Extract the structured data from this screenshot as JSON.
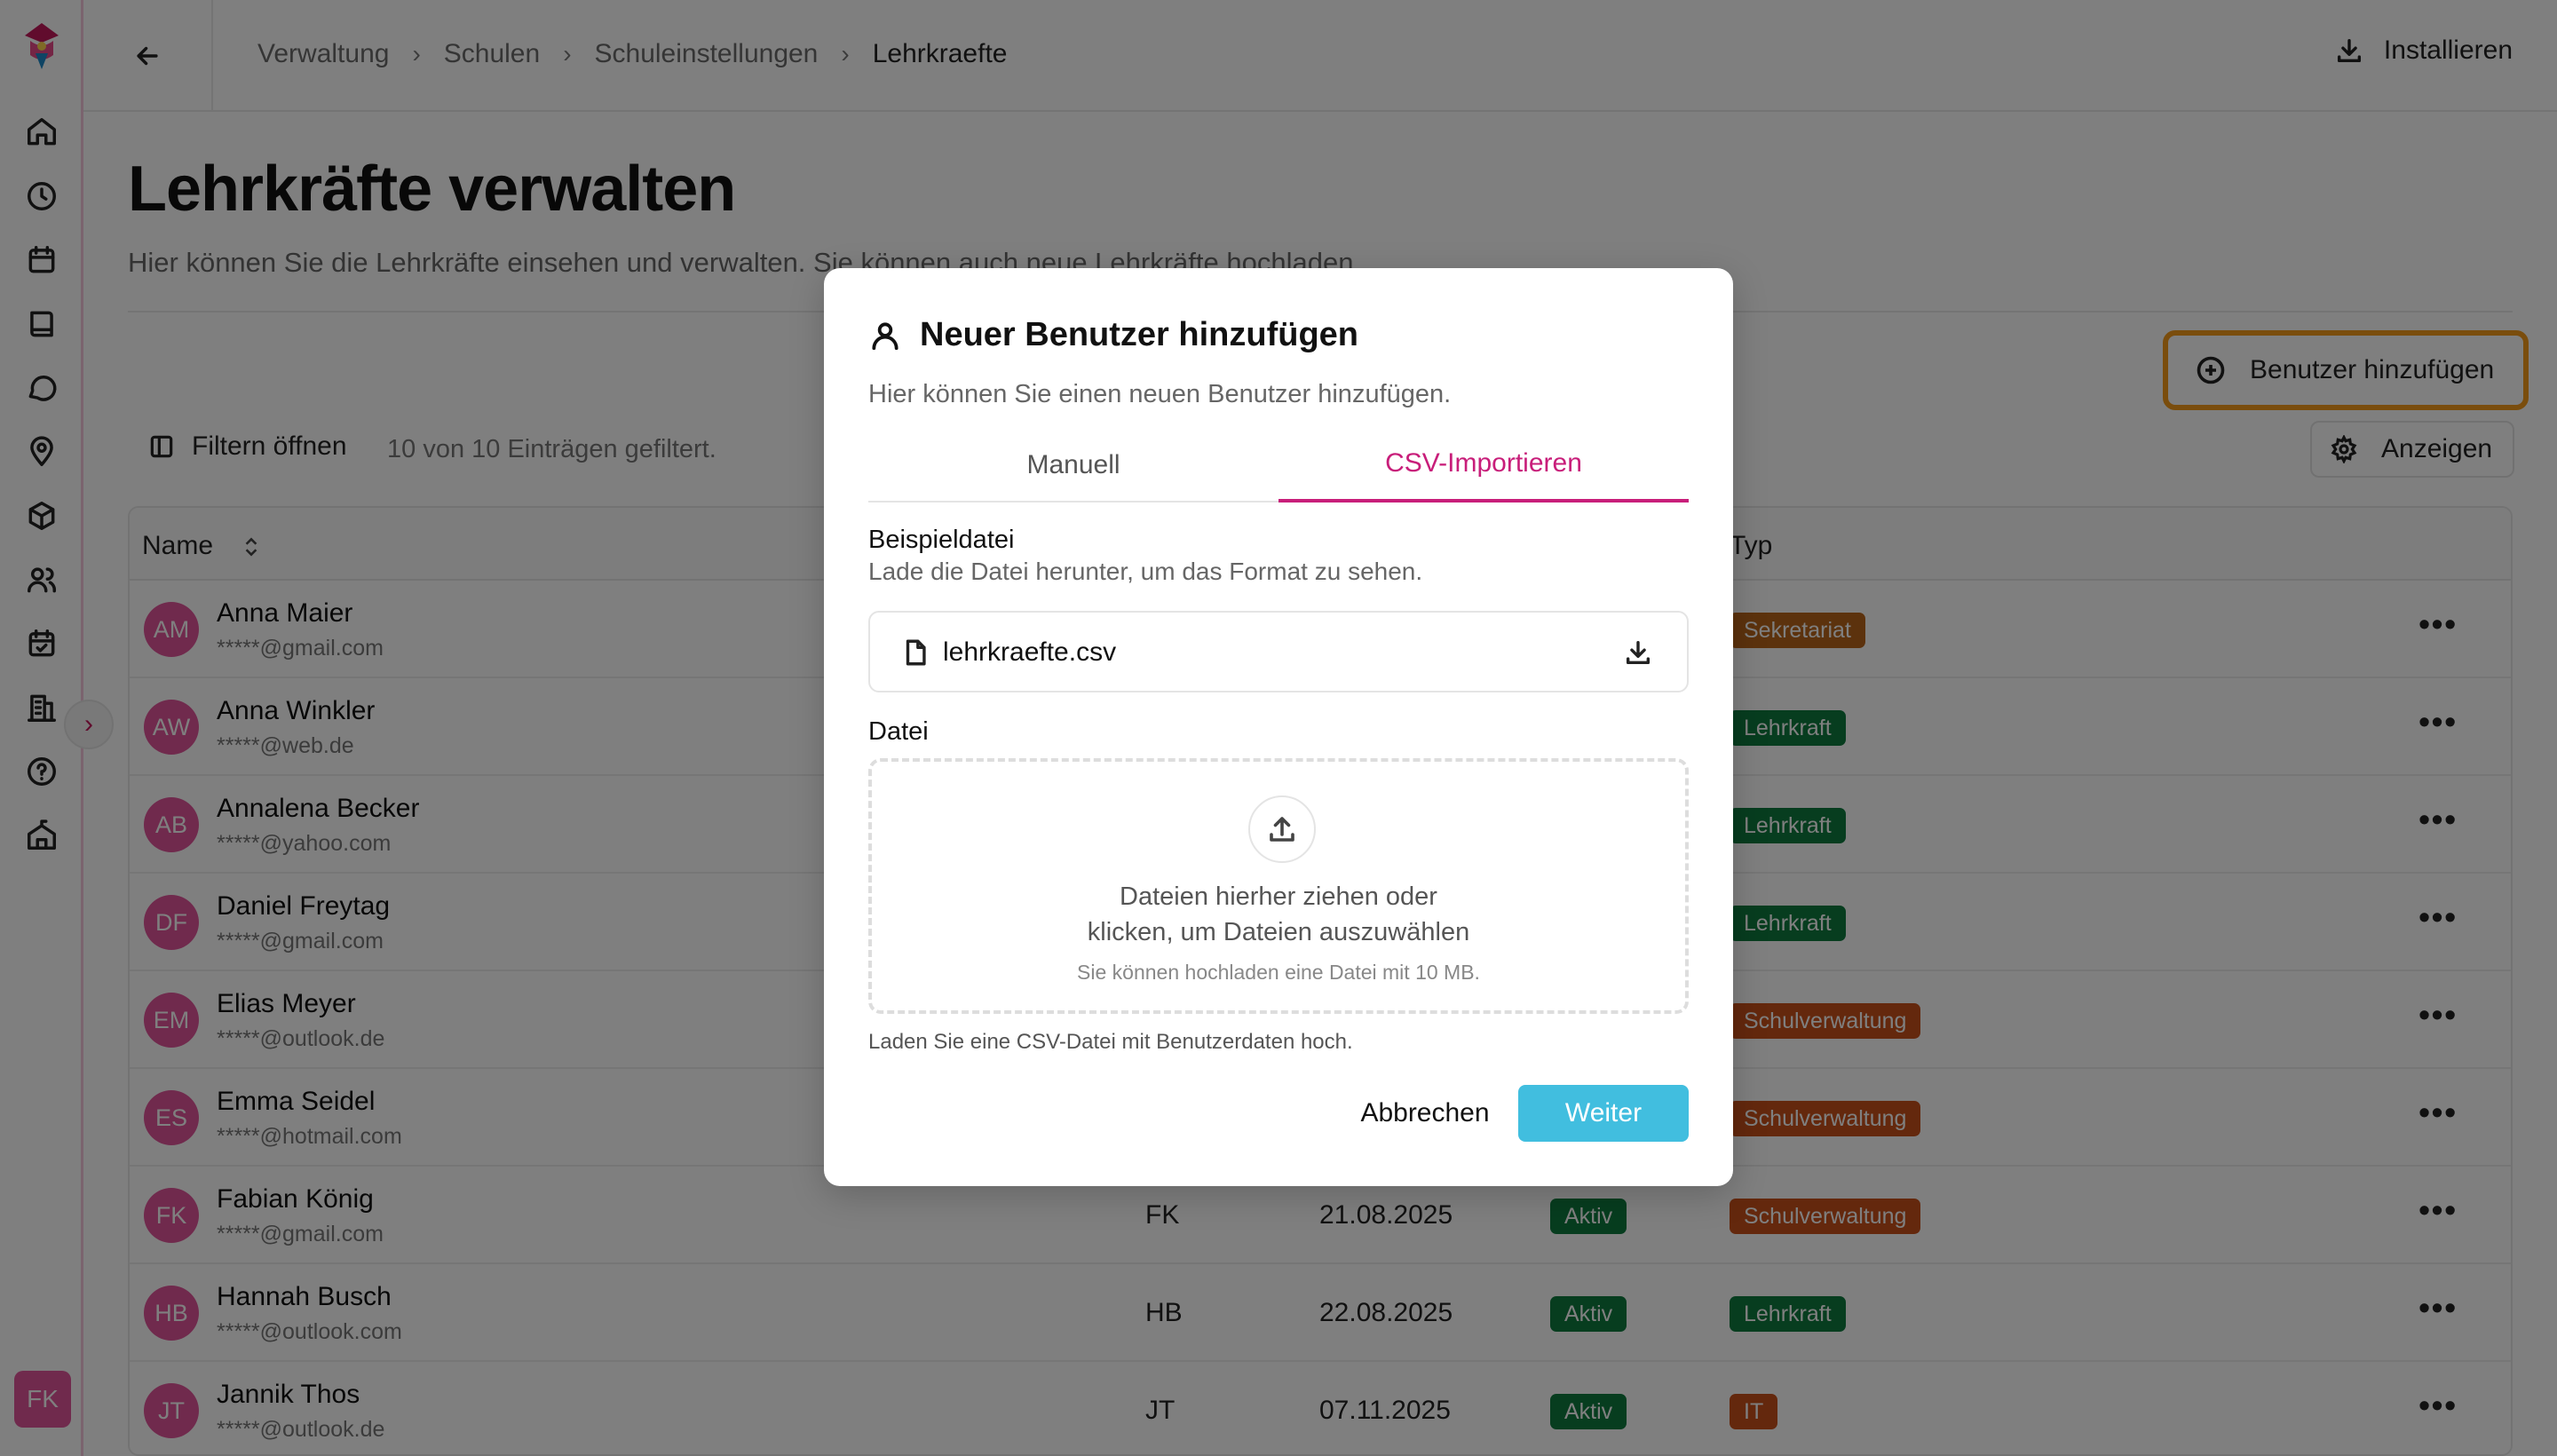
{
  "header": {
    "breadcrumbs": [
      "Verwaltung",
      "Schulen",
      "Schuleinstellungen",
      "Lehrkraefte"
    ],
    "install_label": "Installieren"
  },
  "sidebar": {
    "icons": [
      "home-icon",
      "clock-icon",
      "calendar-icon",
      "book-icon",
      "chat-icon",
      "location-icon",
      "box-icon",
      "users-icon",
      "calendar-check-icon",
      "building-icon",
      "help-icon",
      "school-icon"
    ],
    "user_initials": "FK"
  },
  "page": {
    "title": "Lehrkräfte verwalten",
    "subtitle": "Hier können Sie die Lehrkräfte einsehen und verwalten. Sie können auch neue Lehrkräfte hochladen."
  },
  "toolbar": {
    "add_user_label": "Benutzer hinzufügen",
    "show_label": "Anzeigen",
    "filter_label": "Filtern öffnen",
    "filter_info": "10 von 10 Einträgen gefiltert."
  },
  "table": {
    "columns": {
      "name": "Name",
      "typ": "Typ"
    },
    "rows": [
      {
        "initials": "AM",
        "name": "Anna Maier",
        "email": "*****@gmail.com",
        "kuerzel": "",
        "date": "",
        "status": "",
        "type": "Sekretariat",
        "type_color": "#b8651a"
      },
      {
        "initials": "AW",
        "name": "Anna Winkler",
        "email": "*****@web.de",
        "kuerzel": "",
        "date": "",
        "status": "",
        "type": "Lehrkraft",
        "type_color": "#0f7a3e"
      },
      {
        "initials": "AB",
        "name": "Annalena Becker",
        "email": "*****@yahoo.com",
        "kuerzel": "",
        "date": "",
        "status": "",
        "type": "Lehrkraft",
        "type_color": "#0f7a3e"
      },
      {
        "initials": "DF",
        "name": "Daniel Freytag",
        "email": "*****@gmail.com",
        "kuerzel": "",
        "date": "",
        "status": "",
        "type": "Lehrkraft",
        "type_color": "#0f7a3e"
      },
      {
        "initials": "EM",
        "name": "Elias Meyer",
        "email": "*****@outlook.de",
        "kuerzel": "",
        "date": "",
        "status": "",
        "type": "Schulverwaltung",
        "type_color": "#c8501a"
      },
      {
        "initials": "ES",
        "name": "Emma Seidel",
        "email": "*****@hotmail.com",
        "kuerzel": "",
        "date": "",
        "status": "",
        "type": "Schulverwaltung",
        "type_color": "#c8501a"
      },
      {
        "initials": "FK",
        "name": "Fabian König",
        "email": "*****@gmail.com",
        "kuerzel": "FK",
        "date": "21.08.2025",
        "status": "Aktiv",
        "type": "Schulverwaltung",
        "type_color": "#c8501a"
      },
      {
        "initials": "HB",
        "name": "Hannah Busch",
        "email": "*****@outlook.com",
        "kuerzel": "HB",
        "date": "22.08.2025",
        "status": "Aktiv",
        "type": "Lehrkraft",
        "type_color": "#0f7a3e"
      },
      {
        "initials": "JT",
        "name": "Jannik Thos",
        "email": "*****@outlook.de",
        "kuerzel": "JT",
        "date": "07.11.2025",
        "status": "Aktiv",
        "type": "IT",
        "type_color": "#c8501a"
      }
    ],
    "more_label": "•••"
  },
  "modal": {
    "title": "Neuer Benutzer hinzufügen",
    "description": "Hier können Sie einen neuen Benutzer hinzufügen.",
    "tabs": [
      "Manuell",
      "CSV-Importieren"
    ],
    "active_tab": "CSV-Importieren",
    "example_label": "Beispieldatei",
    "example_hint": "Lade die Datei herunter, um das Format zu sehen.",
    "example_file": "lehrkraefte.csv",
    "file_label": "Datei",
    "dropzone_line1": "Dateien hierher ziehen oder",
    "dropzone_line2": "klicken, um Dateien auszuwählen",
    "dropzone_note": "Sie können hochladen eine Datei mit 10 MB.",
    "csv_hint": "Laden Sie eine CSV-Datei mit Benutzerdaten hoch.",
    "cancel_label": "Abbrechen",
    "next_label": "Weiter"
  },
  "colors": {
    "accent": "#c81e7a",
    "avatar": "#e0559a",
    "highlight": "#f59a1b",
    "primary_button": "#41bedf",
    "status_active": "#0f7a3e"
  }
}
